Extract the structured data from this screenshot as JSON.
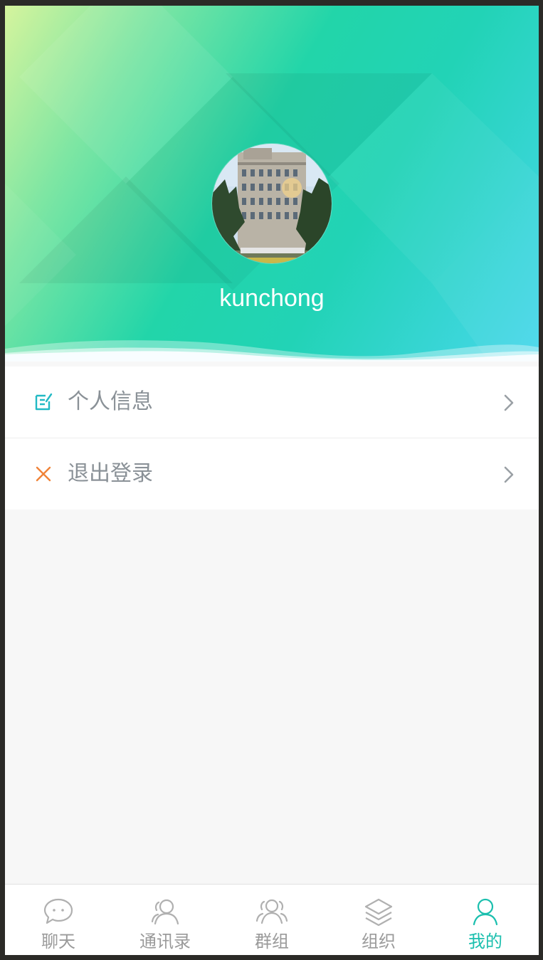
{
  "profile": {
    "username": "kunchong"
  },
  "menu": {
    "items": [
      {
        "label": "个人信息",
        "icon": "edit-icon",
        "icon_color": "#22b9c4"
      },
      {
        "label": "退出登录",
        "icon": "close-icon",
        "icon_color": "#f08338"
      }
    ]
  },
  "tabbar": {
    "tabs": [
      {
        "label": "聊天",
        "icon": "chat-bubble-icon",
        "active": false
      },
      {
        "label": "通讯录",
        "icon": "contact-icon",
        "active": false
      },
      {
        "label": "群组",
        "icon": "group-icon",
        "active": false
      },
      {
        "label": "组织",
        "icon": "layers-icon",
        "active": false
      },
      {
        "label": "我的",
        "icon": "user-icon",
        "active": true
      }
    ],
    "active_color": "#1bbfae",
    "inactive_color": "#9a9a9a"
  }
}
